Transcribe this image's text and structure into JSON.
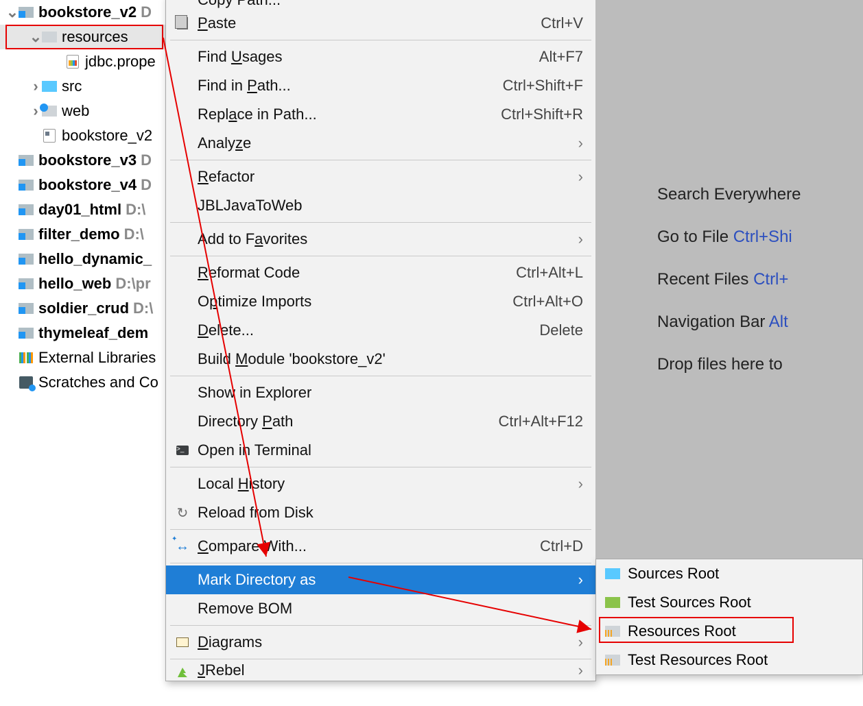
{
  "tree": {
    "items": [
      {
        "label": "bookstore_v2",
        "path": "D",
        "bold": true,
        "chev": "down",
        "icon": "folder"
      },
      {
        "label": "resources",
        "indent": 1,
        "chev": "down",
        "icon": "folder-plain",
        "selected": true
      },
      {
        "label": "jdbc.prope",
        "indent": 2,
        "icon": "prop-file"
      },
      {
        "label": "src",
        "indent": 1,
        "chev": "right",
        "icon": "folder-blue"
      },
      {
        "label": "web",
        "indent": 1,
        "chev": "right",
        "icon": "web-folder"
      },
      {
        "label": "bookstore_v2",
        "indent": 1,
        "icon": "iml-file"
      },
      {
        "label": "bookstore_v3",
        "path": "D",
        "bold": true,
        "icon": "folder"
      },
      {
        "label": "bookstore_v4",
        "path": "D",
        "bold": true,
        "icon": "folder"
      },
      {
        "label": "day01_html",
        "path": "D:\\",
        "bold": true,
        "icon": "folder"
      },
      {
        "label": "filter_demo",
        "path": "D:\\",
        "bold": true,
        "icon": "folder"
      },
      {
        "label": "hello_dynamic_",
        "bold": true,
        "icon": "folder"
      },
      {
        "label": "hello_web",
        "path": "D:\\pr",
        "bold": true,
        "icon": "folder"
      },
      {
        "label": "soldier_crud",
        "path": "D:\\",
        "bold": true,
        "icon": "folder"
      },
      {
        "label": "thymeleaf_dem",
        "bold": true,
        "icon": "folder"
      },
      {
        "label": "External Libraries",
        "icon": "extlib"
      },
      {
        "label": "Scratches and Co",
        "icon": "scratch"
      }
    ]
  },
  "menu": [
    {
      "label": "Copy Path...",
      "truncated": true
    },
    {
      "label": "Paste",
      "u": 0,
      "shortcut": "Ctrl+V",
      "icon": "paste"
    },
    {
      "sep": true
    },
    {
      "label": "Find Usages",
      "u": 5,
      "shortcut": "Alt+F7"
    },
    {
      "label": "Find in Path...",
      "u": 8,
      "shortcut": "Ctrl+Shift+F"
    },
    {
      "label": "Replace in Path...",
      "u": 4,
      "shortcut": "Ctrl+Shift+R"
    },
    {
      "label": "Analyze",
      "u": 5,
      "submenu": true
    },
    {
      "sep": true
    },
    {
      "label": "Refactor",
      "u": 0,
      "submenu": true
    },
    {
      "label": "JBLJavaToWeb"
    },
    {
      "sep": true
    },
    {
      "label": "Add to Favorites",
      "u": 8,
      "submenu": true
    },
    {
      "sep": true
    },
    {
      "label": "Reformat Code",
      "u": 0,
      "shortcut": "Ctrl+Alt+L"
    },
    {
      "label": "Optimize Imports",
      "u": 1,
      "shortcut": "Ctrl+Alt+O"
    },
    {
      "label": "Delete...",
      "u": 0,
      "shortcut": "Delete"
    },
    {
      "label": "Build Module 'bookstore_v2'",
      "u": 6
    },
    {
      "sep": true
    },
    {
      "label": "Show in Explorer"
    },
    {
      "label": "Directory Path",
      "u": 10,
      "shortcut": "Ctrl+Alt+F12"
    },
    {
      "label": "Open in Terminal",
      "icon": "terminal"
    },
    {
      "sep": true
    },
    {
      "label": "Local History",
      "u": 6,
      "submenu": true
    },
    {
      "label": "Reload from Disk",
      "icon": "reload"
    },
    {
      "sep": true
    },
    {
      "label": "Compare With...",
      "u": 0,
      "shortcut": "Ctrl+D",
      "icon": "compare"
    },
    {
      "sep": true
    },
    {
      "label": "Mark Directory as",
      "submenu": true,
      "highlight": true
    },
    {
      "label": "Remove BOM"
    },
    {
      "sep": true
    },
    {
      "label": "Diagrams",
      "u": 0,
      "submenu": true,
      "icon": "diagram"
    },
    {
      "sep": true
    },
    {
      "label": "JRebel",
      "u": 0,
      "submenu": true,
      "icon": "jrebel",
      "last": true
    }
  ],
  "submenu": [
    {
      "label": "Sources Root",
      "icon": "folder-blue"
    },
    {
      "label": "Test Sources Root",
      "icon": "folder-green"
    },
    {
      "label": "Resources Root",
      "icon": "folder-orange",
      "boxed": true
    },
    {
      "label": "Test Resources Root",
      "icon": "folder-orange-test"
    }
  ],
  "hints": {
    "search": {
      "t": "Search Everywhere"
    },
    "gotofile": {
      "t": "Go to File ",
      "k": "Ctrl+Shi"
    },
    "recent": {
      "t": "Recent Files ",
      "k": "Ctrl+"
    },
    "navbar": {
      "t": "Navigation Bar ",
      "k": "Alt"
    },
    "drop": {
      "t": "Drop files here to"
    }
  }
}
